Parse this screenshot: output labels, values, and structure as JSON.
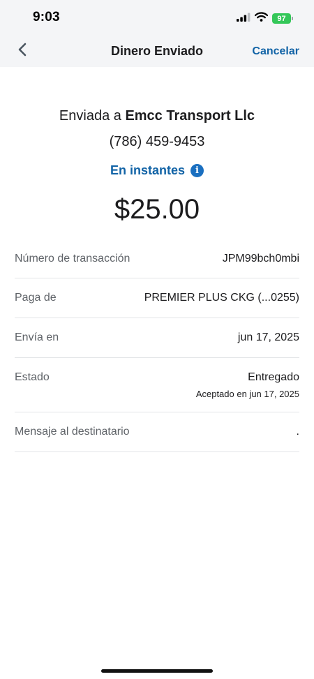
{
  "status_bar": {
    "time": "9:03",
    "battery": "97"
  },
  "nav": {
    "title": "Dinero Enviado",
    "cancel_label": "Cancelar"
  },
  "summary": {
    "sent_to_prefix": "Enviada a ",
    "recipient_name": "Emcc Transport Llc",
    "recipient_phone": "(786) 459-9453",
    "speed_label": "En instantes",
    "amount": "$25.00"
  },
  "details": {
    "transaction_number": {
      "label": "Número de transacción",
      "value": "JPM99bch0mbi"
    },
    "pay_from": {
      "label": "Paga de",
      "value": "PREMIER PLUS CKG (...0255)"
    },
    "send_on": {
      "label": "Envía en",
      "value": "jun 17, 2025"
    },
    "status": {
      "label": "Estado",
      "value": "Entregado",
      "subtext": "Aceptado en jun 17, 2025"
    },
    "recipient_message": {
      "label": "Mensaje al destinatario",
      "value": "."
    }
  },
  "colors": {
    "accent": "#1163a6",
    "header_background": "#f4f5f7",
    "battery": "#34c759",
    "divider": "#e2e4e7"
  }
}
